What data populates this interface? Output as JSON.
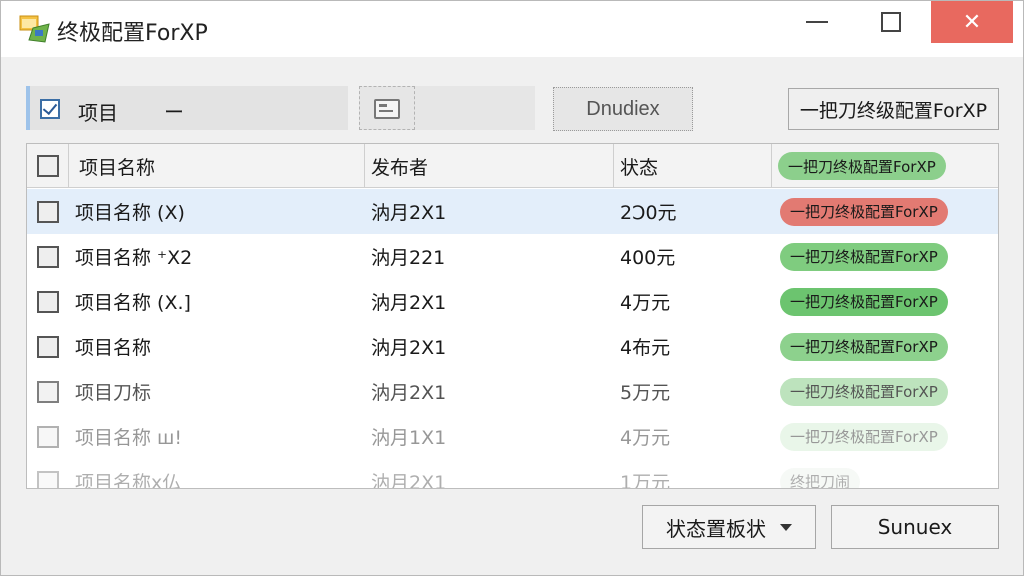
{
  "window": {
    "title": "终极配置ForXP",
    "close_glyph": "✕"
  },
  "toolbar": {
    "left_label": "项目",
    "left_dash": "ー",
    "dropdown_label": "Dnudiex",
    "right_button": "一把刀终级配置ForXP"
  },
  "table": {
    "headers": {
      "name": "项目名称",
      "publisher": "发布者",
      "status": "状态",
      "tag": "一把刀终极配置ForXP"
    },
    "rows": [
      {
        "name": "项目名称 (X)",
        "publisher": "汭月2X1",
        "status": "2Ͻ0元",
        "tag": "一把刀终极配置ForXP",
        "tag_color": "#e27a72",
        "selected": true,
        "opacity": 1
      },
      {
        "name": "项目名称 ⁺X2",
        "publisher": "汭月221",
        "status": "400元",
        "tag": "一把刀终极配置ForXP",
        "tag_color": "#7fcc7f",
        "selected": false,
        "opacity": 1
      },
      {
        "name": "项目名称 (X.]",
        "publisher": "汭月2X1",
        "status": "4万元",
        "tag": "一把刀终极配置ForXP",
        "tag_color": "#6cc46f",
        "selected": false,
        "opacity": 1
      },
      {
        "name": "项目名称",
        "publisher": "汭月2X1",
        "status": "4布元",
        "tag": "一把刀终极配置ForXP",
        "tag_color": "#8dd18d",
        "selected": false,
        "opacity": 1
      },
      {
        "name": "项目刀标",
        "publisher": "汭月2X1",
        "status": "5万元",
        "tag": "一把刀终极配置ForXP",
        "tag_color": "#a7daa7",
        "selected": false,
        "opacity": 0.75
      },
      {
        "name": "项目名称 ш!",
        "publisher": "汭月1X1",
        "status": "4万元",
        "tag": "一把刀终极配置ForXP",
        "tag_color": "#cfeccf",
        "selected": false,
        "opacity": 0.45
      },
      {
        "name": "项目名称x仏",
        "publisher": "汭月2X1",
        "status": "1万元",
        "tag": "终把刀闹",
        "tag_color": "#e8efe8",
        "selected": false,
        "opacity": 0.35
      }
    ]
  },
  "footer": {
    "status_button": "状态置板状",
    "confirm_button": "Sunuex"
  },
  "colors": {
    "close_bg": "#e8695f",
    "selection": "#e3eefa",
    "accent_border": "#9ec3ea"
  }
}
